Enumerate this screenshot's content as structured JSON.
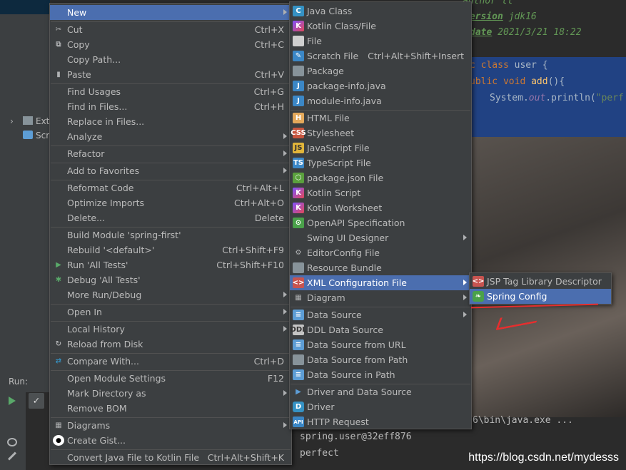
{
  "editor": {
    "doc_author": "author  ll",
    "doc_version_tag": "version",
    "doc_version_value": "jdk16",
    "doc_date_tag": "date",
    "doc_date_value": "2021/3/21 18:22",
    "line1_kw": "c class",
    "line1_name": "user {",
    "line2_kw": "ublic void",
    "line2_fn": "add",
    "line2_rest": "(){",
    "line3_a": "System.",
    "line3_field": "out",
    "line3_b": ".println(",
    "line3_str": "\"perf"
  },
  "tree": {
    "ext_label": "Exte",
    "scr_label": "Scr"
  },
  "run": {
    "label": "Run:",
    "console_path": "6\\bin\\java.exe ...",
    "console_line1": "spring.user@32eff876",
    "console_line2": "perfect"
  },
  "watermark": "https://blog.csdn.net/mydesss",
  "context_menu": {
    "new": "New",
    "cut": "Cut",
    "cut_sc": "Ctrl+X",
    "copy": "Copy",
    "copy_sc": "Ctrl+C",
    "copy_path": "Copy Path...",
    "paste": "Paste",
    "paste_sc": "Ctrl+V",
    "find_usages": "Find Usages",
    "find_usages_sc": "Ctrl+G",
    "find_in_files": "Find in Files...",
    "find_in_files_sc": "Ctrl+H",
    "replace_in_files": "Replace in Files...",
    "analyze": "Analyze",
    "refactor": "Refactor",
    "add_to_favorites": "Add to Favorites",
    "reformat_code": "Reformat Code",
    "reformat_code_sc": "Ctrl+Alt+L",
    "optimize_imports": "Optimize Imports",
    "optimize_imports_sc": "Ctrl+Alt+O",
    "delete": "Delete...",
    "delete_sc": "Delete",
    "build_module": "Build Module 'spring-first'",
    "rebuild": "Rebuild '<default>'",
    "rebuild_sc": "Ctrl+Shift+F9",
    "run_all": "Run 'All Tests'",
    "run_all_sc": "Ctrl+Shift+F10",
    "debug_all": "Debug 'All Tests'",
    "more_run": "More Run/Debug",
    "open_in": "Open In",
    "local_history": "Local History",
    "reload": "Reload from Disk",
    "compare_with": "Compare With...",
    "compare_with_sc": "Ctrl+D",
    "open_module_settings": "Open Module Settings",
    "open_module_settings_sc": "F12",
    "mark_directory": "Mark Directory as",
    "remove_bom": "Remove BOM",
    "diagrams": "Diagrams",
    "create_gist": "Create Gist...",
    "convert_kotlin": "Convert Java File to Kotlin File",
    "convert_kotlin_sc": "Ctrl+Alt+Shift+K"
  },
  "new_menu": {
    "java_class": "Java Class",
    "kotlin_class": "Kotlin Class/File",
    "file": "File",
    "scratch_file": "Scratch File",
    "scratch_file_sc": "Ctrl+Alt+Shift+Insert",
    "package": "Package",
    "package_info": "package-info.java",
    "module_info": "module-info.java",
    "html_file": "HTML File",
    "stylesheet": "Stylesheet",
    "js_file": "JavaScript File",
    "ts_file": "TypeScript File",
    "package_json": "package.json File",
    "kotlin_script": "Kotlin Script",
    "kotlin_worksheet": "Kotlin Worksheet",
    "openapi": "OpenAPI Specification",
    "swing_ui": "Swing UI Designer",
    "editorconfig": "EditorConfig File",
    "resource_bundle": "Resource Bundle",
    "xml_config": "XML Configuration File",
    "diagram": "Diagram",
    "data_source": "Data Source",
    "ddl_data_source": "DDL Data Source",
    "ds_from_url": "Data Source from URL",
    "ds_from_path": "Data Source from Path",
    "ds_in_path": "Data Source in Path",
    "driver_and_ds": "Driver and Data Source",
    "driver": "Driver",
    "http_request": "HTTP Request"
  },
  "xml_menu": {
    "jsp_tag": "JSP Tag Library Descriptor",
    "spring_config": "Spring Config"
  },
  "colors": {
    "selection": "#4b6eaf",
    "menu_bg": "#3c3f41",
    "annotation": "#e62e2e"
  }
}
